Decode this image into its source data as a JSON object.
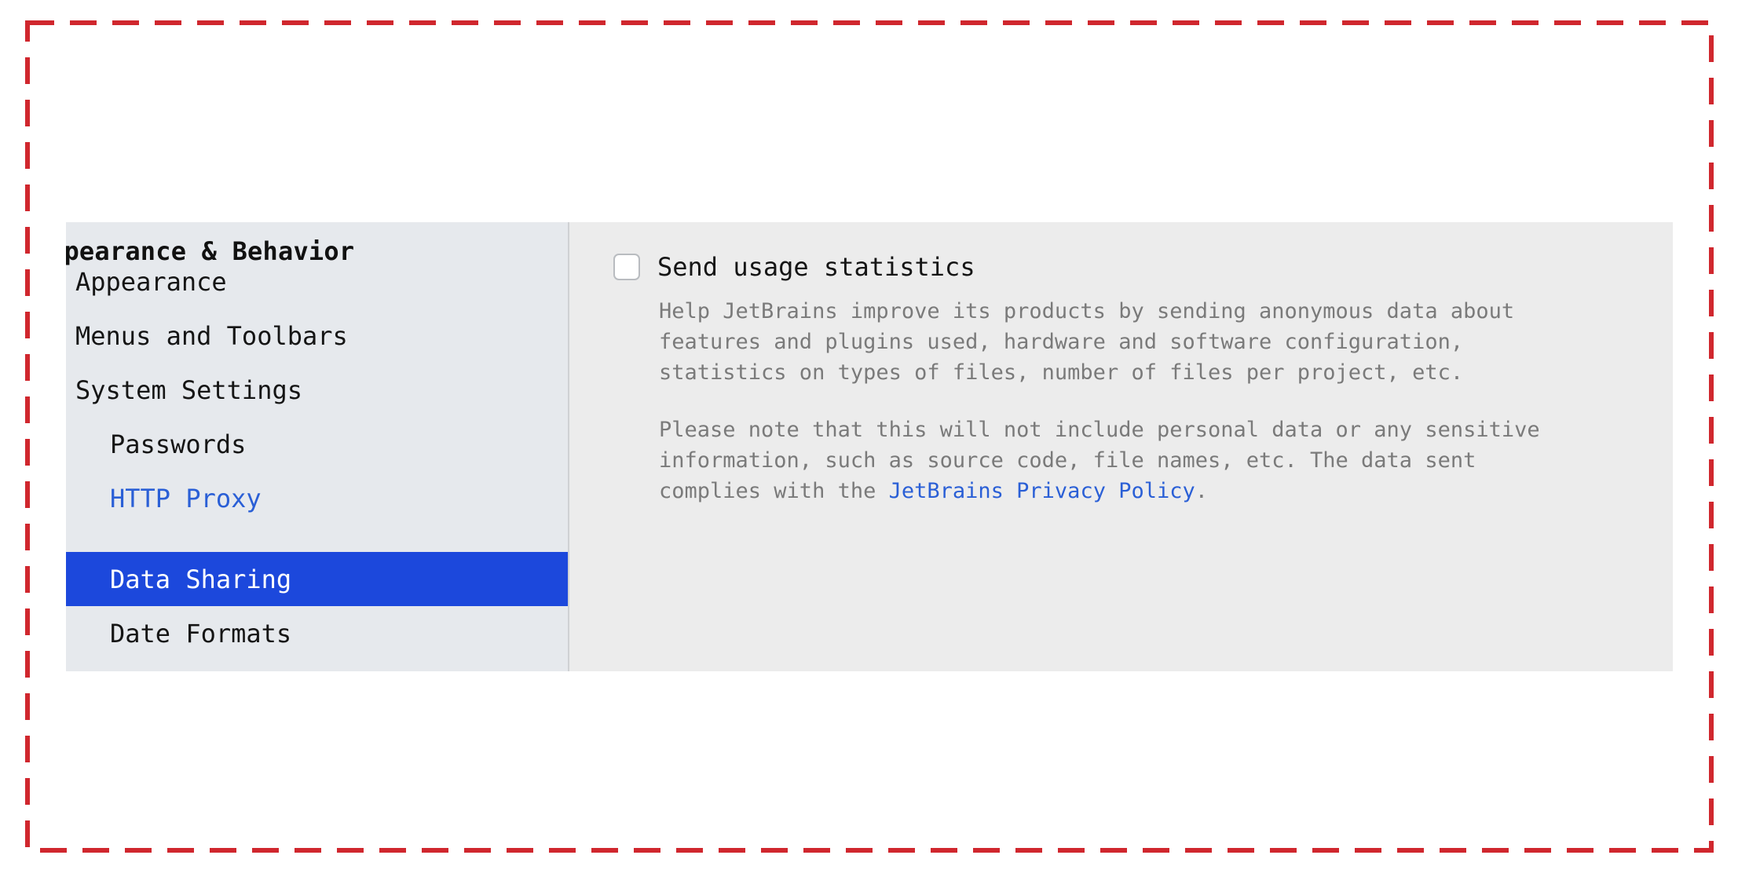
{
  "sidebar": {
    "header": "ppearance & Behavior",
    "items": [
      {
        "label": "Appearance"
      },
      {
        "label": "Menus and Toolbars"
      },
      {
        "label": "System Settings"
      },
      {
        "label": "Passwords"
      },
      {
        "label": "HTTP Proxy"
      },
      {
        "label": "Data Sharing"
      },
      {
        "label": "Date Formats"
      }
    ]
  },
  "content": {
    "checkbox_label": "Send usage statistics",
    "checkbox_checked": false,
    "description1": {
      "line1": "Help JetBrains improve its products by sending anonymous data about",
      "line2": "features and plugins used, hardware and software configuration,",
      "line3": "statistics on types of files, number of files per project, etc."
    },
    "description2": {
      "line1": "Please note that this will not include personal data or any sensitive",
      "line2": "information, such as source code, file names, etc. The data sent",
      "line3_prefix": "complies with the ",
      "link_text": "JetBrains Privacy Policy",
      "line3_suffix": "."
    }
  },
  "colors": {
    "selection": "#1c48dc",
    "link": "#2a5fd6",
    "frame_dash": "#d0272e",
    "sidebar_bg": "#e6e9ed",
    "content_bg": "#ececec"
  }
}
